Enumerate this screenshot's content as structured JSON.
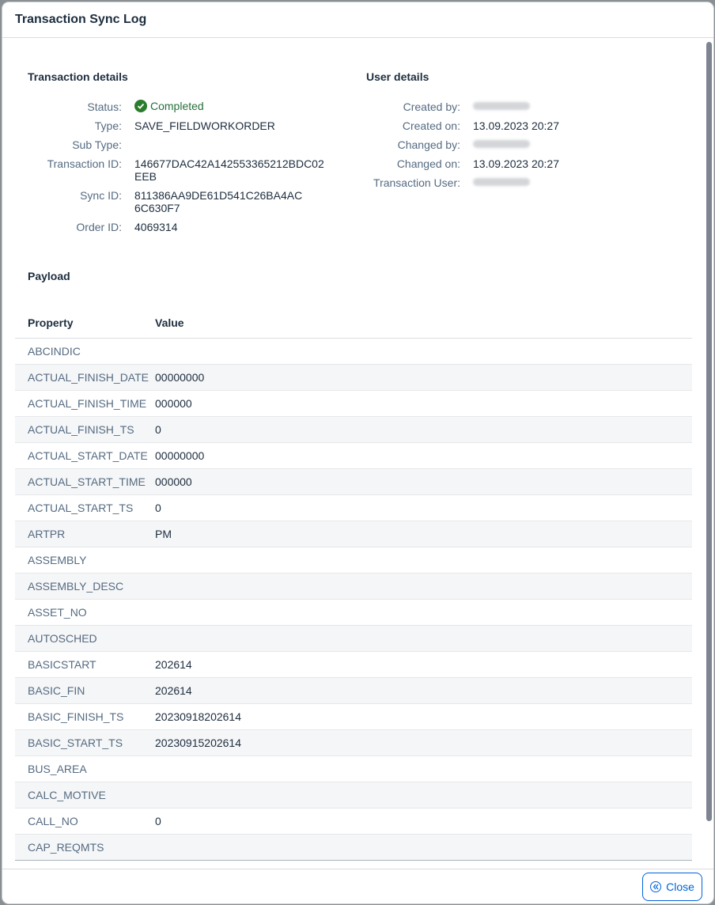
{
  "dialog": {
    "title": "Transaction Sync Log",
    "close_label": "Close"
  },
  "transaction_details": {
    "title": "Transaction details",
    "fields": [
      {
        "label": "Status:",
        "value": "Completed",
        "status": "success"
      },
      {
        "label": "Type:",
        "value": "SAVE_FIELDWORKORDER"
      },
      {
        "label": "Sub Type:",
        "value": ""
      },
      {
        "label": "Transaction ID:",
        "value": "146677DAC42A142553365212BDC02",
        "value2": "EEB"
      },
      {
        "label": "Sync ID:",
        "value": "811386AA9DE61D541C26BA4AC",
        "value2": "6C630F7"
      },
      {
        "label": "Order ID:",
        "value": "4069314"
      }
    ]
  },
  "user_details": {
    "title": "User details",
    "fields": [
      {
        "label": "Created by:",
        "value": "",
        "redacted": true
      },
      {
        "label": "Created on:",
        "value": "13.09.2023 20:27"
      },
      {
        "label": "Changed by:",
        "value": "",
        "redacted": true
      },
      {
        "label": "Changed on:",
        "value": "13.09.2023 20:27"
      },
      {
        "label": "Transaction User:",
        "value": "",
        "redacted": true
      }
    ]
  },
  "payload": {
    "title": "Payload",
    "columns": [
      "Property",
      "Value"
    ],
    "rows": [
      {
        "property": "ABCINDIC",
        "value": ""
      },
      {
        "property": "ACTUAL_FINISH_DATE",
        "value": "00000000"
      },
      {
        "property": "ACTUAL_FINISH_TIME",
        "value": "000000"
      },
      {
        "property": "ACTUAL_FINISH_TS",
        "value": "0"
      },
      {
        "property": "ACTUAL_START_DATE",
        "value": "00000000"
      },
      {
        "property": "ACTUAL_START_TIME",
        "value": "000000"
      },
      {
        "property": "ACTUAL_START_TS",
        "value": "0"
      },
      {
        "property": "ARTPR",
        "value": "PM"
      },
      {
        "property": "ASSEMBLY",
        "value": ""
      },
      {
        "property": "ASSEMBLY_DESC",
        "value": ""
      },
      {
        "property": "ASSET_NO",
        "value": ""
      },
      {
        "property": "AUTOSCHED",
        "value": ""
      },
      {
        "property": "BASICSTART",
        "value": "202614"
      },
      {
        "property": "BASIC_FIN",
        "value": "202614"
      },
      {
        "property": "BASIC_FINISH_TS",
        "value": "20230918202614"
      },
      {
        "property": "BASIC_START_TS",
        "value": "20230915202614"
      },
      {
        "property": "BUS_AREA",
        "value": ""
      },
      {
        "property": "CALC_MOTIVE",
        "value": ""
      },
      {
        "property": "CALL_NO",
        "value": "0"
      },
      {
        "property": "CAP_REQMTS",
        "value": ""
      }
    ]
  },
  "colors": {
    "accent": "#0064d9",
    "success": "#256f3a",
    "label": "#556b82"
  }
}
